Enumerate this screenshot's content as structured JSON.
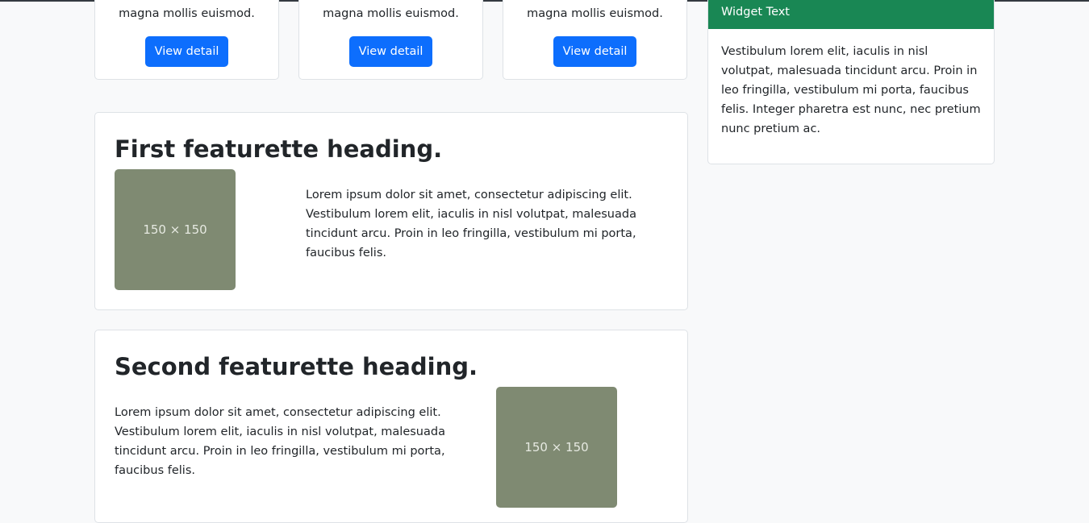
{
  "products": [
    {
      "text": "magna mollis euismod.",
      "button_label": "View detail"
    },
    {
      "text": "magna mollis euismod.",
      "button_label": "View detail"
    },
    {
      "text": "magna mollis euismod.",
      "button_label": "View detail"
    }
  ],
  "featurettes": [
    {
      "heading": "First featurette heading.",
      "image_label": "150 × 150",
      "text": "Lorem ipsum dolor sit amet, consectetur adipiscing elit. Vestibulum lorem elit, iaculis in nisl volutpat, malesuada tincidunt arcu. Proin in leo fringilla, vestibulum mi porta, faucibus felis."
    },
    {
      "heading": "Second featurette heading.",
      "image_label": "150 × 150",
      "text": "Lorem ipsum dolor sit amet, consectetur adipiscing elit. Vestibulum lorem elit, iaculis in nisl volutpat, malesuada tincidunt arcu. Proin in leo fringilla, vestibulum mi porta, faucibus felis."
    }
  ],
  "widget": {
    "title": "Widget Text",
    "body": "Vestibulum lorem elit, iaculis in nisl volutpat, malesuada tincidunt arcu. Proin in leo fringilla, vestibulum mi porta, faucibus felis. Integer pharetra est nunc, nec pretium nunc pretium ac."
  },
  "colors": {
    "page_background": "#f8f9fa",
    "primary_button": "#0d6efd",
    "widget_header": "#198754",
    "placeholder_fill": "#7f8a72"
  }
}
